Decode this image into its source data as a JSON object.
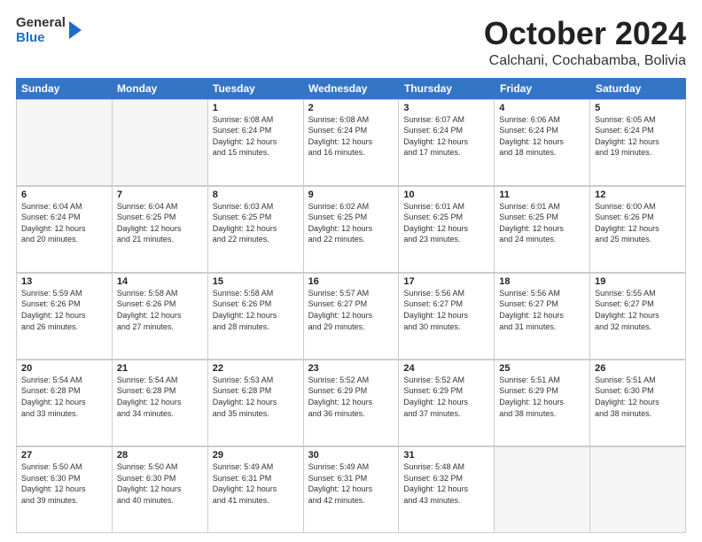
{
  "logo": {
    "general": "General",
    "blue": "Blue"
  },
  "header": {
    "month": "October 2024",
    "location": "Calchani, Cochabamba, Bolivia"
  },
  "weekdays": [
    "Sunday",
    "Monday",
    "Tuesday",
    "Wednesday",
    "Thursday",
    "Friday",
    "Saturday"
  ],
  "weeks": [
    [
      {
        "day": "",
        "info": ""
      },
      {
        "day": "",
        "info": ""
      },
      {
        "day": "1",
        "info": "Sunrise: 6:08 AM\nSunset: 6:24 PM\nDaylight: 12 hours\nand 15 minutes."
      },
      {
        "day": "2",
        "info": "Sunrise: 6:08 AM\nSunset: 6:24 PM\nDaylight: 12 hours\nand 16 minutes."
      },
      {
        "day": "3",
        "info": "Sunrise: 6:07 AM\nSunset: 6:24 PM\nDaylight: 12 hours\nand 17 minutes."
      },
      {
        "day": "4",
        "info": "Sunrise: 6:06 AM\nSunset: 6:24 PM\nDaylight: 12 hours\nand 18 minutes."
      },
      {
        "day": "5",
        "info": "Sunrise: 6:05 AM\nSunset: 6:24 PM\nDaylight: 12 hours\nand 19 minutes."
      }
    ],
    [
      {
        "day": "6",
        "info": "Sunrise: 6:04 AM\nSunset: 6:24 PM\nDaylight: 12 hours\nand 20 minutes."
      },
      {
        "day": "7",
        "info": "Sunrise: 6:04 AM\nSunset: 6:25 PM\nDaylight: 12 hours\nand 21 minutes."
      },
      {
        "day": "8",
        "info": "Sunrise: 6:03 AM\nSunset: 6:25 PM\nDaylight: 12 hours\nand 22 minutes."
      },
      {
        "day": "9",
        "info": "Sunrise: 6:02 AM\nSunset: 6:25 PM\nDaylight: 12 hours\nand 22 minutes."
      },
      {
        "day": "10",
        "info": "Sunrise: 6:01 AM\nSunset: 6:25 PM\nDaylight: 12 hours\nand 23 minutes."
      },
      {
        "day": "11",
        "info": "Sunrise: 6:01 AM\nSunset: 6:25 PM\nDaylight: 12 hours\nand 24 minutes."
      },
      {
        "day": "12",
        "info": "Sunrise: 6:00 AM\nSunset: 6:26 PM\nDaylight: 12 hours\nand 25 minutes."
      }
    ],
    [
      {
        "day": "13",
        "info": "Sunrise: 5:59 AM\nSunset: 6:26 PM\nDaylight: 12 hours\nand 26 minutes."
      },
      {
        "day": "14",
        "info": "Sunrise: 5:58 AM\nSunset: 6:26 PM\nDaylight: 12 hours\nand 27 minutes."
      },
      {
        "day": "15",
        "info": "Sunrise: 5:58 AM\nSunset: 6:26 PM\nDaylight: 12 hours\nand 28 minutes."
      },
      {
        "day": "16",
        "info": "Sunrise: 5:57 AM\nSunset: 6:27 PM\nDaylight: 12 hours\nand 29 minutes."
      },
      {
        "day": "17",
        "info": "Sunrise: 5:56 AM\nSunset: 6:27 PM\nDaylight: 12 hours\nand 30 minutes."
      },
      {
        "day": "18",
        "info": "Sunrise: 5:56 AM\nSunset: 6:27 PM\nDaylight: 12 hours\nand 31 minutes."
      },
      {
        "day": "19",
        "info": "Sunrise: 5:55 AM\nSunset: 6:27 PM\nDaylight: 12 hours\nand 32 minutes."
      }
    ],
    [
      {
        "day": "20",
        "info": "Sunrise: 5:54 AM\nSunset: 6:28 PM\nDaylight: 12 hours\nand 33 minutes."
      },
      {
        "day": "21",
        "info": "Sunrise: 5:54 AM\nSunset: 6:28 PM\nDaylight: 12 hours\nand 34 minutes."
      },
      {
        "day": "22",
        "info": "Sunrise: 5:53 AM\nSunset: 6:28 PM\nDaylight: 12 hours\nand 35 minutes."
      },
      {
        "day": "23",
        "info": "Sunrise: 5:52 AM\nSunset: 6:29 PM\nDaylight: 12 hours\nand 36 minutes."
      },
      {
        "day": "24",
        "info": "Sunrise: 5:52 AM\nSunset: 6:29 PM\nDaylight: 12 hours\nand 37 minutes."
      },
      {
        "day": "25",
        "info": "Sunrise: 5:51 AM\nSunset: 6:29 PM\nDaylight: 12 hours\nand 38 minutes."
      },
      {
        "day": "26",
        "info": "Sunrise: 5:51 AM\nSunset: 6:30 PM\nDaylight: 12 hours\nand 38 minutes."
      }
    ],
    [
      {
        "day": "27",
        "info": "Sunrise: 5:50 AM\nSunset: 6:30 PM\nDaylight: 12 hours\nand 39 minutes."
      },
      {
        "day": "28",
        "info": "Sunrise: 5:50 AM\nSunset: 6:30 PM\nDaylight: 12 hours\nand 40 minutes."
      },
      {
        "day": "29",
        "info": "Sunrise: 5:49 AM\nSunset: 6:31 PM\nDaylight: 12 hours\nand 41 minutes."
      },
      {
        "day": "30",
        "info": "Sunrise: 5:49 AM\nSunset: 6:31 PM\nDaylight: 12 hours\nand 42 minutes."
      },
      {
        "day": "31",
        "info": "Sunrise: 5:48 AM\nSunset: 6:32 PM\nDaylight: 12 hours\nand 43 minutes."
      },
      {
        "day": "",
        "info": ""
      },
      {
        "day": "",
        "info": ""
      }
    ]
  ]
}
